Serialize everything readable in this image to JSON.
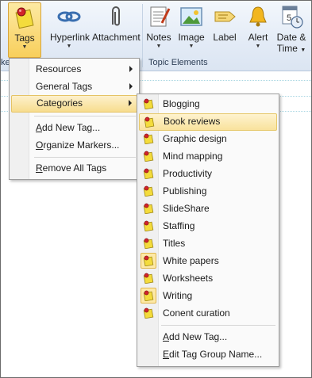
{
  "ribbon": {
    "tags_label": "Tags",
    "buttons": [
      {
        "label": "Hyperlink",
        "icon": "hyperlink-icon"
      },
      {
        "label": "Attachment",
        "icon": "paperclip-icon"
      },
      {
        "label": "Notes",
        "icon": "notes-icon"
      },
      {
        "label": "Image",
        "icon": "image-icon"
      },
      {
        "label": "Label",
        "icon": "label-icon"
      },
      {
        "label": "Alert",
        "icon": "bell-icon"
      },
      {
        "label": "Date &",
        "label2": "Time",
        "icon": "calendar-icon"
      }
    ],
    "group_topic": "Topic Elements",
    "group_left_fragment": "ke"
  },
  "menu_main": {
    "items": [
      {
        "label": "Resources",
        "submenu": true
      },
      {
        "label": "General Tags",
        "submenu": true
      },
      {
        "label": "Categories",
        "submenu": true,
        "selected": true
      },
      {
        "label": "Add New Tag...",
        "underline_char": "A"
      },
      {
        "label": "Organize Markers...",
        "underline_char": "O"
      },
      {
        "label": "Remove All Tags",
        "underline_char": "R"
      }
    ]
  },
  "menu_categories": {
    "items": [
      {
        "label": "Blogging"
      },
      {
        "label": "Book reviews",
        "highlighted": true
      },
      {
        "label": "Graphic design"
      },
      {
        "label": "Mind mapping"
      },
      {
        "label": "Productivity"
      },
      {
        "label": "Publishing"
      },
      {
        "label": "SlideShare"
      },
      {
        "label": "Staffing"
      },
      {
        "label": "Titles"
      },
      {
        "label": "White papers",
        "checked": true
      },
      {
        "label": "Worksheets"
      },
      {
        "label": "Writing",
        "checked": true
      },
      {
        "label": "Conent curation"
      }
    ],
    "actions": [
      {
        "label": "Add New Tag...",
        "underline_char": "A"
      },
      {
        "label": "Edit Tag Group Name...",
        "underline_char": "E"
      }
    ]
  },
  "colors": {
    "ribbon_bg": "#e3ebf6",
    "selection": "#f7dd8e",
    "tag_yellow": "#f7e04a",
    "pin_red": "#d2242b"
  }
}
